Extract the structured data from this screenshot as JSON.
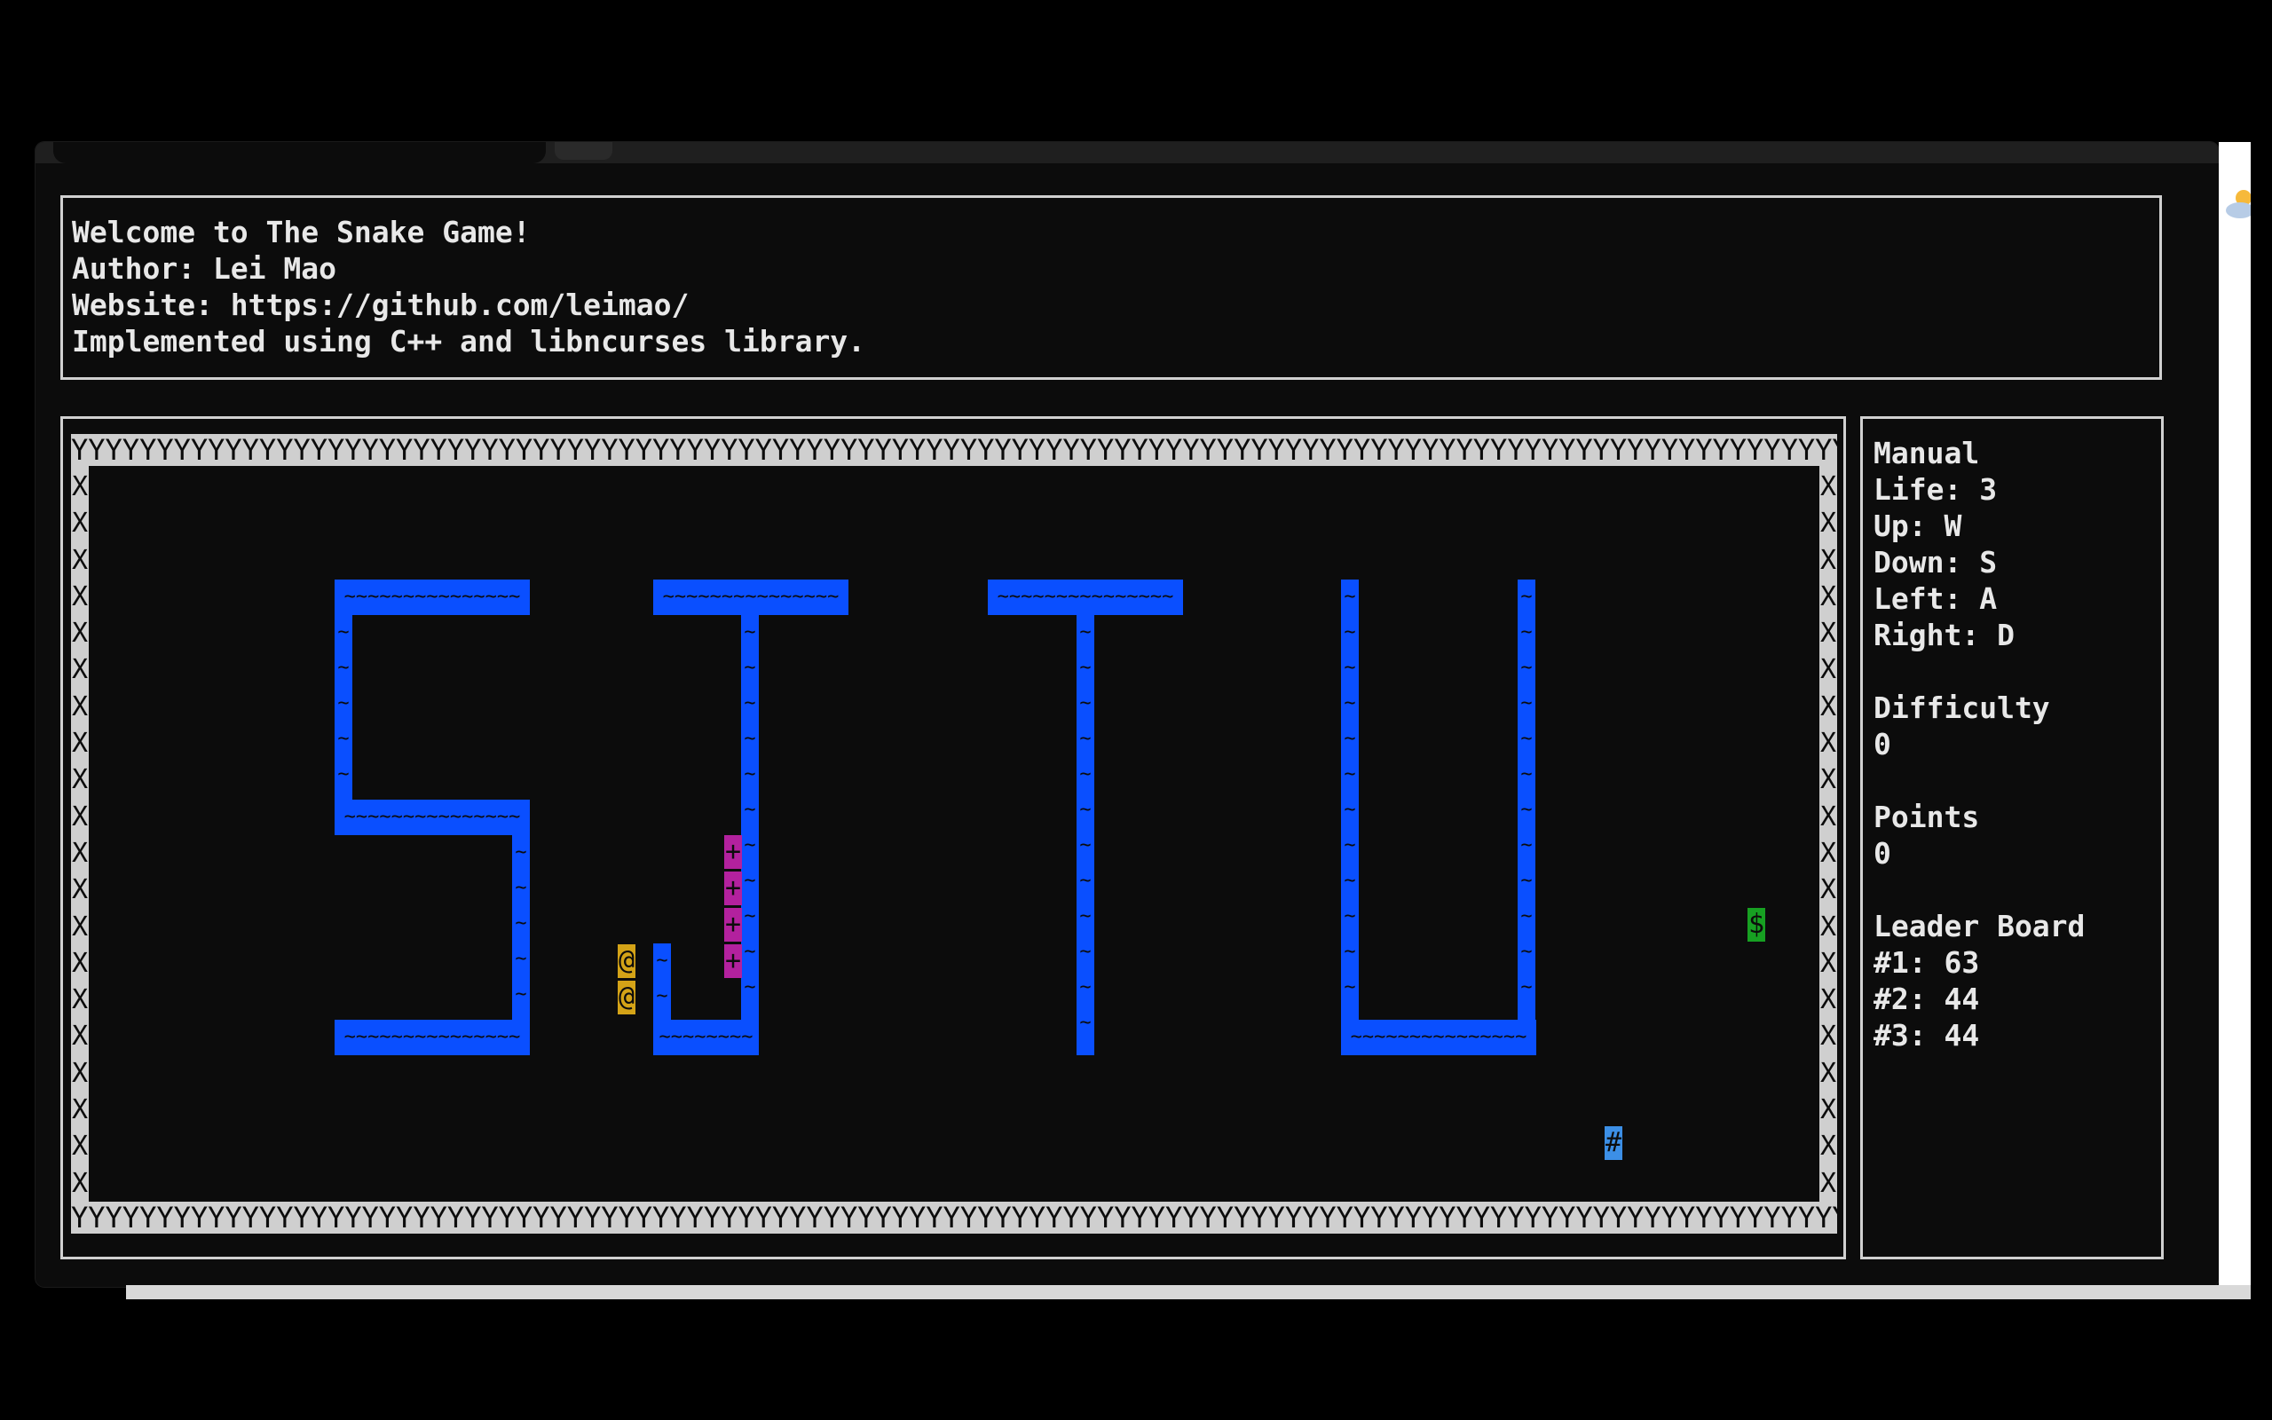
{
  "header": {
    "line1": "Welcome to The Snake Game!",
    "line2": "Author: Lei Mao",
    "line3": "Website: https://github.com/leimao/",
    "line4": "Implemented using C++ and libncurses library."
  },
  "board": {
    "border_top_char": "Y",
    "border_side_char": "X",
    "wall_char": "~",
    "snake_char": "+",
    "worm_char": "@",
    "food_char": "$",
    "bonus_char": "#",
    "wall_letters": "SJTU"
  },
  "sidebar": {
    "manual_title": "Manual",
    "life": "Life: 3",
    "up": "Up: W",
    "down": "Down: S",
    "left": "Left: A",
    "right": "Right: D",
    "difficulty_title": "Difficulty",
    "difficulty_value": "0",
    "points_title": "Points",
    "points_value": "0",
    "leaderboard_title": "Leader Board",
    "rank1": "#1: 63",
    "rank2": "#2: 44",
    "rank3": "#3: 44"
  },
  "colors": {
    "wall": "#0a4fff",
    "snake": "#b3219e",
    "worm": "#d4a317",
    "food": "#17a022",
    "bonus": "#3c8fe6",
    "frame": "#cfcfcf"
  }
}
